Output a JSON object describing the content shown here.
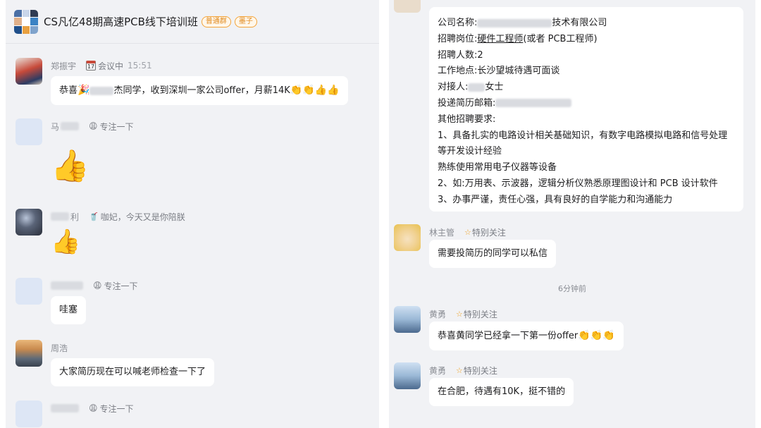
{
  "left_chat": {
    "group_name": "CS凡亿48期高速PCB线下培训班",
    "tags": [
      "普通群",
      "墨子"
    ],
    "messages": [
      {
        "sender": "郑振宇",
        "badge_icon": "calendar-icon",
        "badge_day": "17",
        "badge": "会议中",
        "time": "15:51",
        "text_pre": "恭喜",
        "text_post": "杰同学，收到深圳一家公司offer，月薪14K",
        "emojis": "👏👏👍👍"
      },
      {
        "sender": "马",
        "badge": "专注一下",
        "content": "👍"
      },
      {
        "sender": "利",
        "badge": "咖妃，今天又是你陪朕",
        "content": "👍"
      },
      {
        "badge": "专注一下",
        "text": "哇塞"
      },
      {
        "sender": "周浩",
        "text": "大家简历现在可以喊老师检查一下了"
      },
      {
        "badge": "专注一下"
      }
    ]
  },
  "right_chat": {
    "job_post": {
      "company_prefix": "公司名称:",
      "company_suffix": "技术有限公司",
      "position_prefix": "招聘岗位:",
      "position_underlined": "硬件工程师",
      "position_suffix": "(或者 PCB工程师)",
      "headcount": "招聘人数:2",
      "location": "工作地点:长沙望城待遇可面谈",
      "contact_prefix": "对接人:",
      "contact_suffix": "女士",
      "email_prefix": "投递简历邮箱:",
      "other_title": "其他招聘要求:",
      "req1_a": "1、具备扎实的电路设计相关基础知识，有数字电路模拟电路和信号处理",
      "req1_b": "等开发设计经验",
      "req1_c": "熟练使用常用电子仪器等设备",
      "req2": "2、如:万用表、示波器，逻辑分析仪熟悉原理图设计和 PCB 设计软件",
      "req3": "3、办事严谨，责任心强，具有良好的自学能力和沟通能力"
    },
    "messages": [
      {
        "sender": "林主管",
        "badge": "特别关注",
        "text": "需要投简历的同学可以私信"
      },
      {
        "sender": "黄勇",
        "badge": "特别关注",
        "text": "恭喜黄同学已经拿一下第一份offer",
        "emojis": "👏👏👏"
      },
      {
        "sender": "黄勇",
        "badge": "特别关注",
        "text": "在合肥，待遇有10K，挺不错的"
      }
    ],
    "timestamp": "6分钟前"
  },
  "colors": {
    "panel_bg": "#f1f2f5",
    "bubble_bg": "#ffffff",
    "meta_text": "#8a8d94",
    "tag_orange": "#e08a1e"
  }
}
